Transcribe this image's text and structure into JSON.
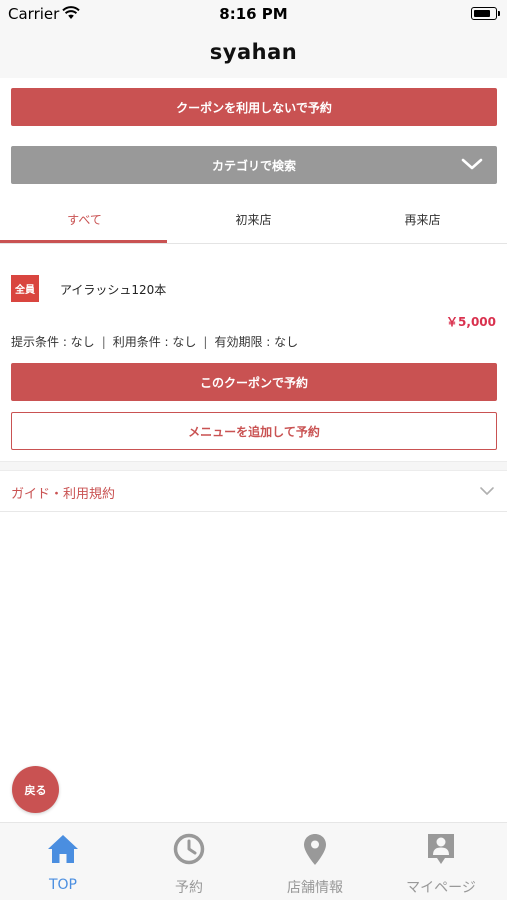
{
  "status_bar": {
    "carrier": "Carrier",
    "time": "8:16 PM",
    "battery_level": 0.8
  },
  "header": {
    "title": "syahan"
  },
  "actions": {
    "no_coupon_reserve": "クーポンを利用しないで予約",
    "category_search": "カテゴリで検索"
  },
  "tabs": [
    {
      "label": "すべて",
      "active": true
    },
    {
      "label": "初来店",
      "active": false
    },
    {
      "label": "再来店",
      "active": false
    }
  ],
  "coupon": {
    "badge": "全員",
    "name": "アイラッシュ120本",
    "price": "￥5,000",
    "conditions": [
      "提示条件 : なし",
      "利用条件 : なし",
      "有効期限 : なし"
    ],
    "separator": "|",
    "use_button": "このクーポンで予約",
    "add_menu_button": "メニューを追加して予約"
  },
  "guide": {
    "label": "ガイド・利用規約"
  },
  "back_button": {
    "label": "戻る"
  },
  "tab_bar": [
    {
      "label": "TOP",
      "icon": "home-icon",
      "active": true
    },
    {
      "label": "予約",
      "icon": "clock-icon",
      "active": false
    },
    {
      "label": "店舗情報",
      "icon": "map-pin-icon",
      "active": false
    },
    {
      "label": "マイページ",
      "icon": "user-badge-icon",
      "active": false
    }
  ],
  "colors": {
    "accent": "#c95252",
    "badge": "#d9453f",
    "price": "#d9314e",
    "category_bar": "#999999",
    "tab_active": "#4a8ee0",
    "tab_inactive": "#999999"
  }
}
